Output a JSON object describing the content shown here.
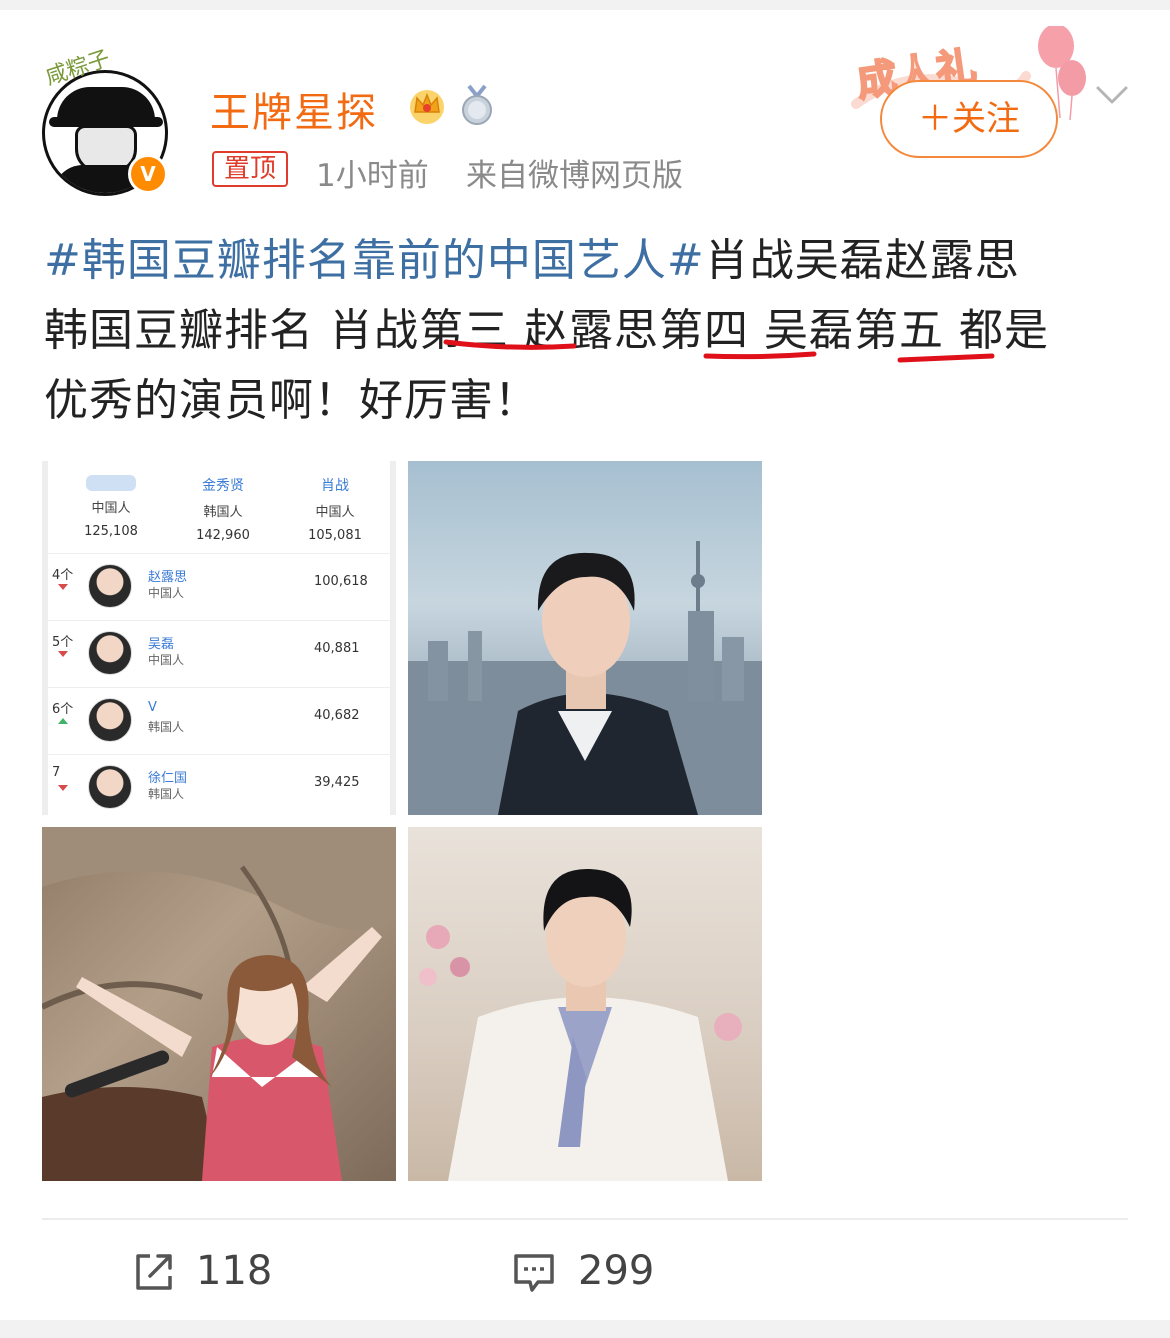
{
  "user": {
    "name": "王牌星探",
    "avatar_tag": "咸粽子",
    "verified_mark": "V"
  },
  "meta": {
    "pinned": "置顶",
    "time": "1小时前",
    "source": "来自微博网页版"
  },
  "header": {
    "follow_label": "＋关注",
    "decoration_text": "成人礼"
  },
  "post": {
    "hashtag": "#韩国豆瓣排名靠前的中国艺人#",
    "text_1": "肖战吴磊赵露思",
    "text_2": "韩国豆瓣排名 肖战",
    "third": "第三",
    "text_3": " 赵露思",
    "fourth": "第四",
    "text_4": " 吴磊",
    "fifth": "第五",
    "text_5": " 都是",
    "text_6": "优秀的演员啊！好厉害！"
  },
  "ranking": {
    "top": [
      {
        "name": "",
        "nationality": "中国人",
        "score": "125,108"
      },
      {
        "name": "金秀贤",
        "nationality": "韩国人",
        "score": "142,960"
      },
      {
        "name": "肖战",
        "nationality": "中国人",
        "score": "105,081"
      }
    ],
    "rows": [
      {
        "rank": "4个",
        "trend": "down",
        "name": "赵露思",
        "nationality": "中国人",
        "score": "100,618"
      },
      {
        "rank": "5个",
        "trend": "down",
        "name": "吴磊",
        "nationality": "中国人",
        "score": "40,881"
      },
      {
        "rank": "6个",
        "trend": "up",
        "name": "V",
        "nationality": "韩国人",
        "score": "40,682"
      },
      {
        "rank": "7",
        "trend": "down",
        "name": "徐仁国",
        "nationality": "韩国人",
        "score": "39,425"
      }
    ]
  },
  "actions": {
    "share_count": "118",
    "comment_count": "299"
  },
  "colors": {
    "username": "#f26b12",
    "hashtag": "#3e6fa3",
    "underline": "#e0101a",
    "pin": "#e03c2c"
  }
}
